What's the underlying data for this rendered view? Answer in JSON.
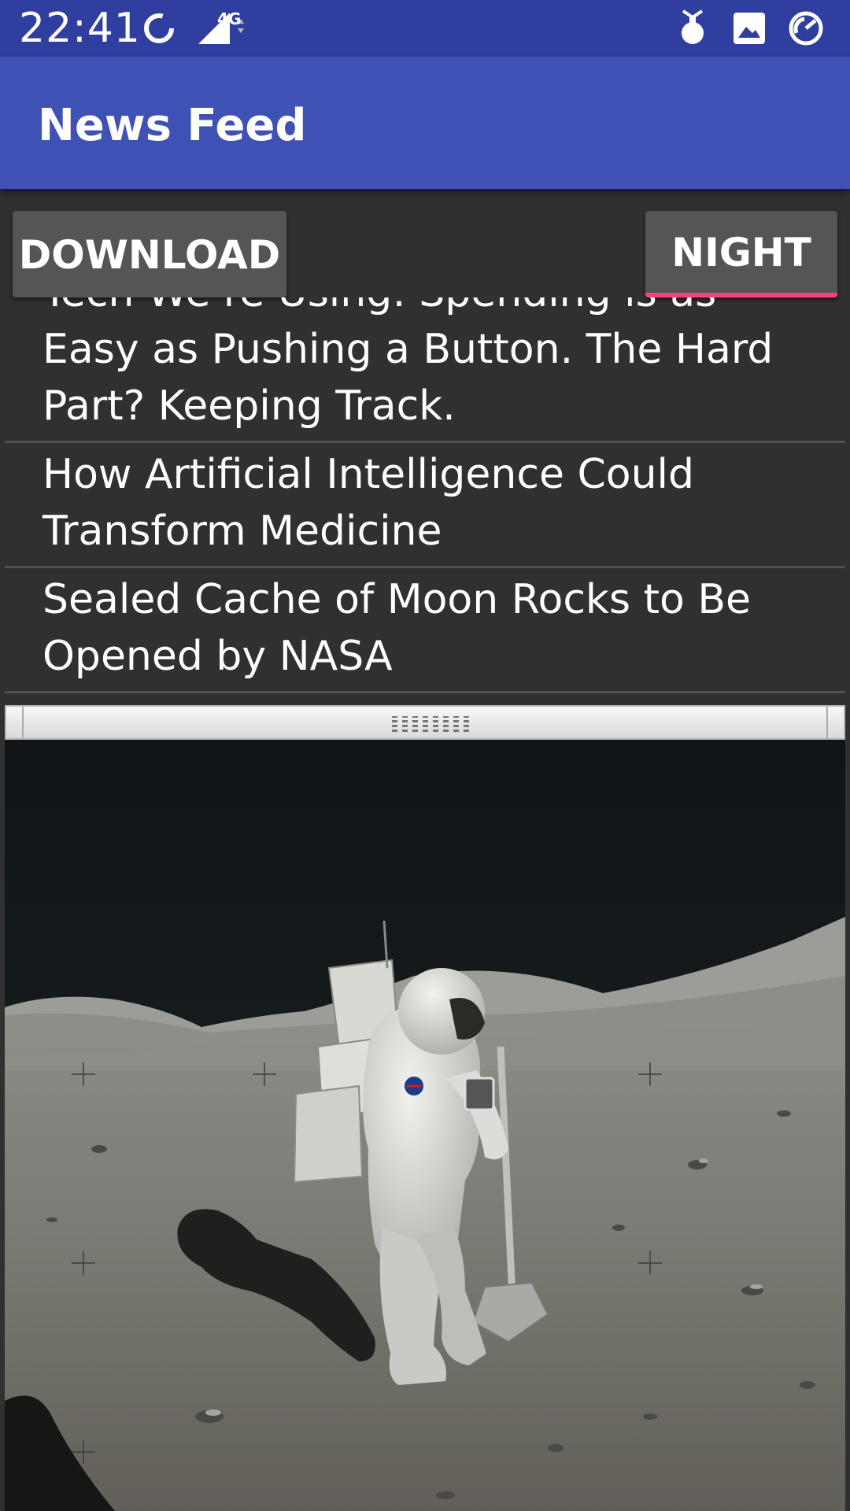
{
  "status_bar": {
    "time": "22:41",
    "network": "4G",
    "icons": [
      "sync-icon",
      "signal-icon",
      "bomb-notification-icon",
      "image-notification-icon",
      "speedometer-icon"
    ]
  },
  "app_bar": {
    "title": "News Feed"
  },
  "buttons": {
    "download": "DOWNLOAD",
    "night": "NIGHT"
  },
  "news": {
    "items": [
      {
        "title": " Tech We’re Using: Spending is as Easy as Pushing a Button. The Hard Part? Keeping Track."
      },
      {
        "title": " How Artificial Intelligence Could Transform Medicine"
      },
      {
        "title": " Sealed Cache of Moon Rocks to Be Opened by NASA"
      }
    ]
  },
  "colors": {
    "status_bar": "#303f9f",
    "app_bar": "#3f51b5",
    "background": "#303030",
    "button": "#555555",
    "accent": "#ff4081"
  }
}
